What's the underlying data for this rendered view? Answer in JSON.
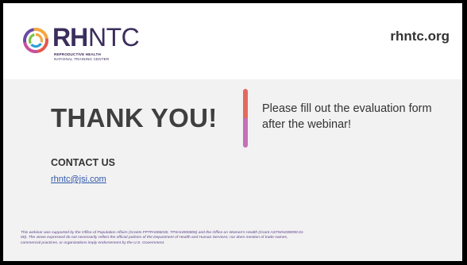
{
  "header": {
    "logo": {
      "rh": "RH",
      "ntc": "NTC",
      "line1": "REPRODUCTIVE HEALTH",
      "line2": "NATIONAL TRAINING CENTER"
    },
    "site_url": "rhntc.org"
  },
  "main": {
    "thanks": "THANK YOU!",
    "evaluation_message": "Please fill out the evaluation form after the webinar!"
  },
  "contact": {
    "heading": "CONTACT US",
    "email": "rhntc@jsi.com"
  },
  "footer": {
    "disclaimer": "This webinar was supported by the Office of Population Affairs (Grants FPTPA006030, TPSAH000006) and the Office on Women's Health (Grant ASTWH200090-01-00). The views expressed do not necessarily reflect the official policies of the Department of Health and Human Services; nor does mention of trade names, commercial practices, or organizations imply endorsement by the U.S. Government."
  },
  "colors": {
    "logo_text": "#3b2d5c",
    "divider_top": "#e46a5e",
    "divider_bottom": "#c56fb8",
    "link": "#2f57a9",
    "disclaimer": "#5a3f8a"
  }
}
